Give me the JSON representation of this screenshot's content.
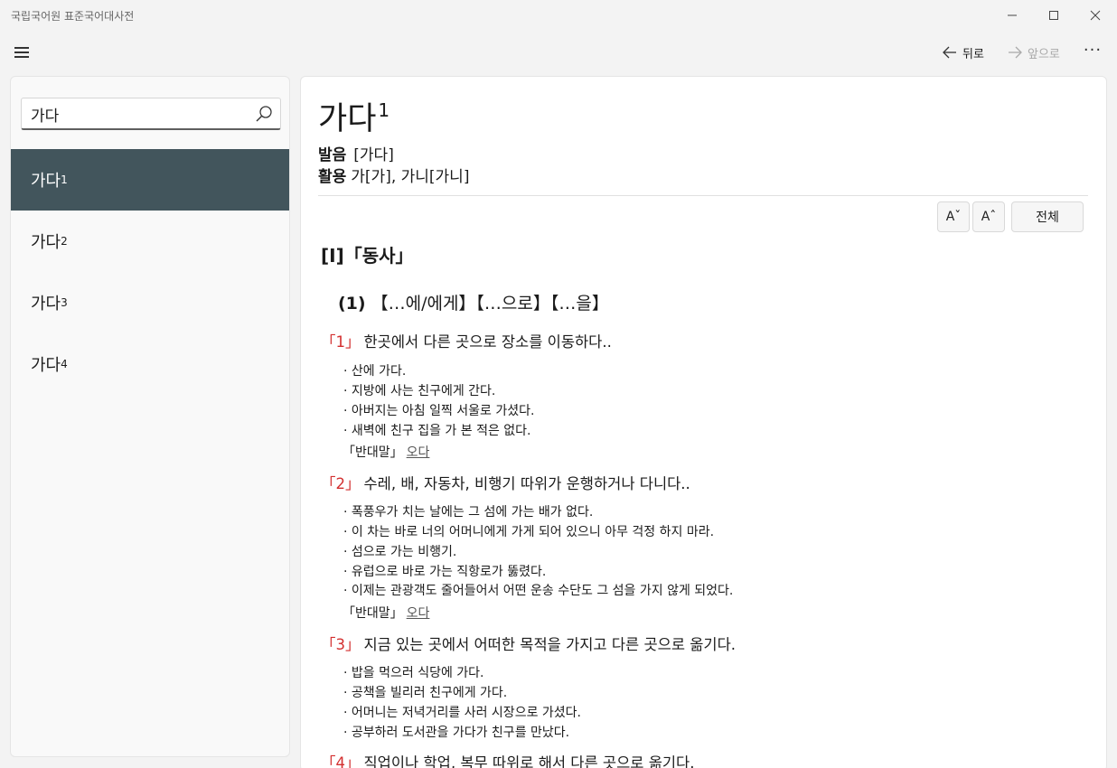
{
  "window": {
    "title": "국립국어원 표준국어대사전",
    "min_glyph": "—",
    "max_glyph": "☐",
    "close_glyph": "✕"
  },
  "toolbar": {
    "back_label": "뒤로",
    "forward_label": "앞으로",
    "more_label": "···"
  },
  "search": {
    "value": "가다"
  },
  "results": [
    {
      "word": "가다",
      "sup": "1",
      "selected": true
    },
    {
      "word": "가다",
      "sup": "2",
      "selected": false
    },
    {
      "word": "가다",
      "sup": "3",
      "selected": false
    },
    {
      "word": "가다",
      "sup": "4",
      "selected": false
    }
  ],
  "entry": {
    "headword": "가다",
    "homonym": "1",
    "pronunciation_label": "발음",
    "pronunciation": "[가다]",
    "inflection_label": "활용",
    "inflection": "가[가], 가니[가니]",
    "font_down_label": "Aˇ",
    "font_up_label": "Aˆ",
    "all_label": "전체",
    "pos": "[Ⅰ]「동사」",
    "pattern_num": "(1)",
    "pattern": "【…에/에게】【…으로】【…을】",
    "senses": [
      {
        "num": "「1」",
        "def": "한곳에서 다른 곳으로 장소를 이동하다..",
        "examples": [
          "· 산에 가다.",
          "· 지방에 사는 친구에게 간다.",
          "· 아버지는 아침 일찍 서울로 가셨다.",
          "· 새벽에 친구 집을 가 본 적은 없다."
        ],
        "antonym_label": "「반대말」",
        "antonym": "오다"
      },
      {
        "num": "「2」",
        "def": "수레, 배, 자동차, 비행기 따위가 운행하거나 다니다..",
        "examples": [
          "· 폭풍우가 치는 날에는 그 섬에 가는 배가 없다.",
          "· 이 차는 바로 너의 어머니에게 가게 되어 있으니 아무 걱정 하지 마라.",
          "· 섬으로 가는 비행기.",
          "· 유럽으로 바로 가는 직항로가 뚫렸다.",
          "· 이제는 관광객도 줄어들어서 어떤 운송 수단도 그 섬을 가지 않게 되었다."
        ],
        "antonym_label": "「반대말」",
        "antonym": "오다"
      },
      {
        "num": "「3」",
        "def": "지금 있는 곳에서 어떠한 목적을 가지고 다른 곳으로 옮기다.",
        "examples": [
          "· 밥을 먹으러 식당에 가다.",
          "· 공책을 빌리러 친구에게 가다.",
          "· 어머니는 저녁거리를 사러 시장으로 가셨다.",
          "· 공부하러 도서관을 가다가 친구를 만났다."
        ]
      },
      {
        "num": "「4」",
        "def": "직업이나 학업, 복무 따위로 해서 다른 곳으로 옮기다."
      }
    ]
  }
}
